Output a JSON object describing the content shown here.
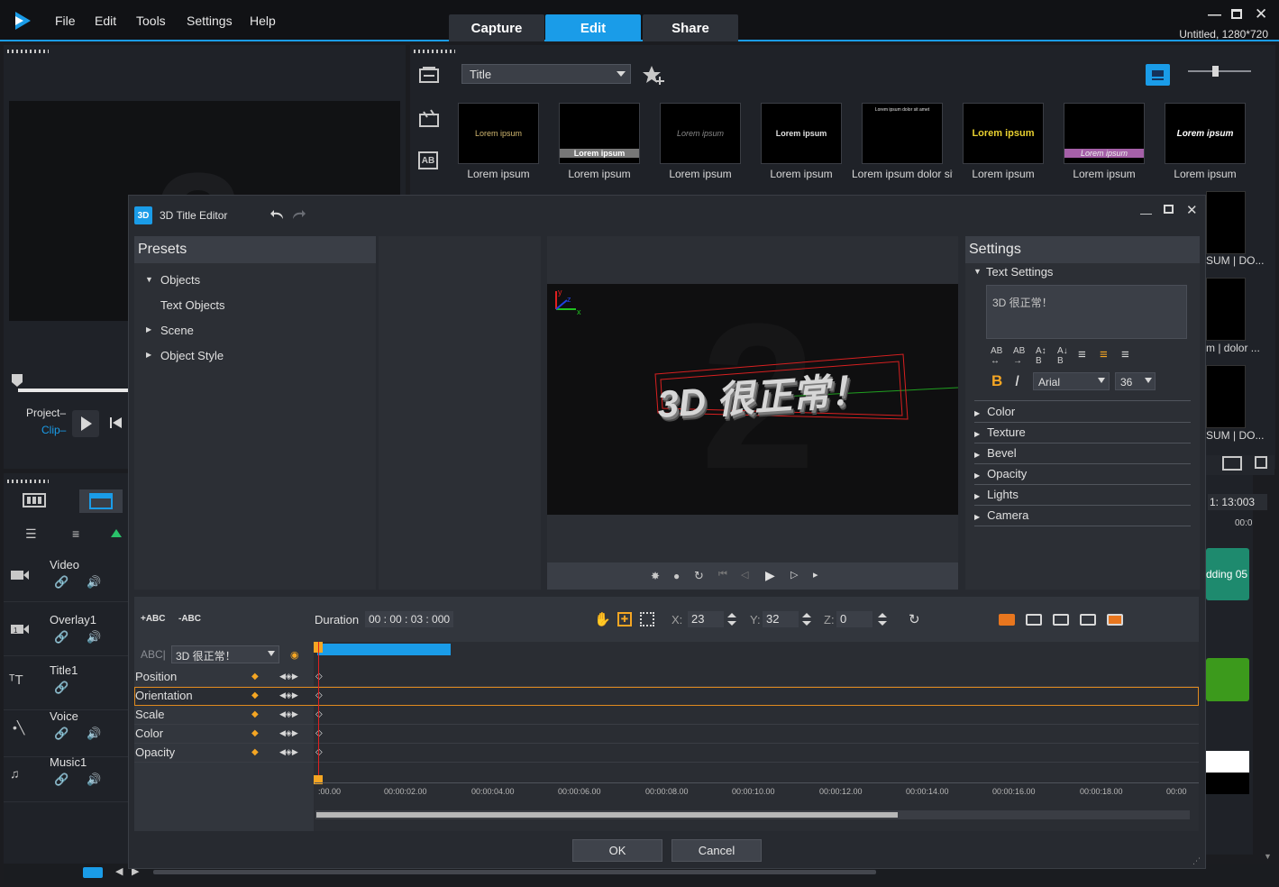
{
  "menu": {
    "file": "File",
    "edit": "Edit",
    "tools": "Tools",
    "settings": "Settings",
    "help": "Help"
  },
  "modes": {
    "capture": "Capture",
    "edit": "Edit",
    "share": "Share"
  },
  "project_info": "Untitled, 1280*720",
  "library": {
    "category": "Title",
    "thumbs": [
      {
        "label": "Lorem ipsum",
        "text": "Lorem ipsum"
      },
      {
        "label": "Lorem ipsum",
        "text": "Lorem ipsum"
      },
      {
        "label": "Lorem ipsum",
        "text": "Lorem ipsum"
      },
      {
        "label": "Lorem ipsum",
        "text": "Lorem ipsum"
      },
      {
        "label": "Lorem ipsum dolor sit...",
        "text": "Lorem ipsum dolor sit amet"
      },
      {
        "label": "Lorem ipsum",
        "text": "Lorem ipsum"
      },
      {
        "label": "Lorem ipsum",
        "text": "Lorem ipsum"
      },
      {
        "label": "Lorem ipsum",
        "text": "Lorem ipsum"
      }
    ],
    "strip_labels": [
      "SUM | DO...",
      "m | dolor ...",
      "SUM | DO..."
    ],
    "timecode": "1: 13:003",
    "ruler_short": "00:0",
    "clip_label": "dding 05"
  },
  "player": {
    "project": "Project",
    "clip": "Clip"
  },
  "tracks": [
    {
      "label": "Video"
    },
    {
      "label": "Overlay1"
    },
    {
      "label": "Title1"
    },
    {
      "label": "Voice"
    },
    {
      "label": "Music1"
    }
  ],
  "dialog": {
    "title": "3D Title Editor",
    "icon_label": "3D",
    "presets_head": "Presets",
    "presets": {
      "objects": "Objects",
      "text_objects": "Text Objects",
      "scene": "Scene",
      "object_style": "Object Style"
    },
    "viewport_text": "3D 很正常！",
    "settings_head": "Settings",
    "text_settings": "Text Settings",
    "text_value": "3D 很正常！",
    "font": "Arial",
    "font_size": "36",
    "bold": "B",
    "italic": "I",
    "sections": [
      "Color",
      "Texture",
      "Bevel",
      "Opacity",
      "Lights",
      "Camera"
    ],
    "add_abc": "+ABC",
    "remove_abc": "-ABC",
    "duration_label": "Duration",
    "duration_value": "00 : 00 : 03 : 000",
    "x_label": "X:",
    "x_value": "23",
    "y_label": "Y:",
    "y_value": "32",
    "z_label": "Z:",
    "z_value": "0",
    "object_select": "3D 很正常！",
    "object_prefix": "ABC|",
    "properties": [
      "Position",
      "Orientation",
      "Scale",
      "Color",
      "Opacity"
    ],
    "ruler": [
      ":00.00",
      "00:00:02.00",
      "00:00:04.00",
      "00:00:06.00",
      "00:00:08.00",
      "00:00:10.00",
      "00:00:12.00",
      "00:00:14.00",
      "00:00:16.00",
      "00:00:18.00",
      "00:00"
    ],
    "ok": "OK",
    "cancel": "Cancel"
  },
  "colors": {
    "accent": "#1a9ce8",
    "keyframe": "#f5a623",
    "selection": "#e08a1e"
  }
}
